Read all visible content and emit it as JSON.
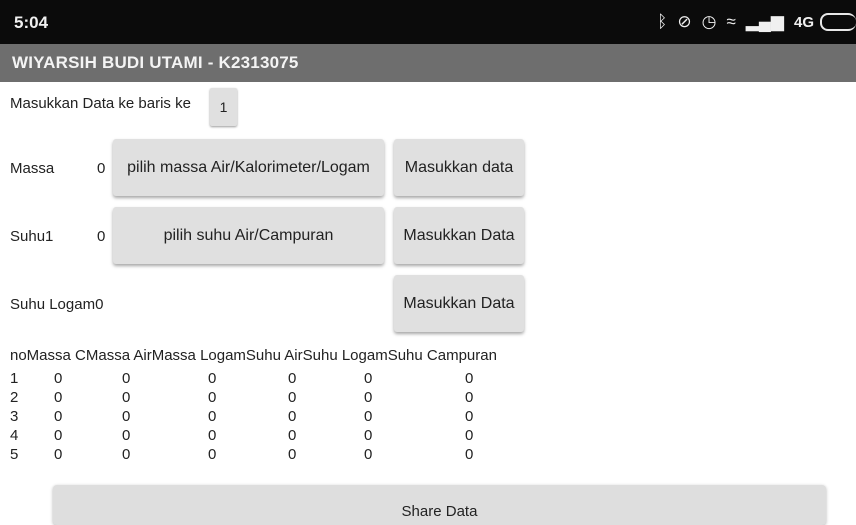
{
  "status_bar": {
    "time": "5:04",
    "network": "4G",
    "icons": [
      "bluetooth-icon",
      "mute-icon",
      "alarm-icon",
      "wifi-icon",
      "signal-icon",
      "battery-icon"
    ]
  },
  "app": {
    "title": "WIYARSIH BUDI UTAMI - K2313075"
  },
  "form": {
    "row_label": "Masukkan Data ke baris ke",
    "row_value": "1",
    "massa_label": "Massa",
    "massa_value": "0",
    "massa_picker": "pilih massa Air/Kalorimeter/Logam",
    "massa_submit": "Masukkan data",
    "suhu1_label": "Suhu1",
    "suhu1_value": "0",
    "suhu_picker": "pilih suhu Air/Campuran",
    "suhu1_submit": "Masukkan Data",
    "suhu_logam_label": "Suhu Logam0",
    "suhu_logam_submit": "Masukkan Data"
  },
  "table": {
    "header": "noMassa CMassa AirMassa LogamSuhu AirSuhu LogamSuhu Campuran",
    "rows": [
      [
        "1",
        "0",
        "0",
        "0",
        "0",
        "0",
        "0"
      ],
      [
        "2",
        "0",
        "0",
        "0",
        "0",
        "0",
        "0"
      ],
      [
        "3",
        "0",
        "0",
        "0",
        "0",
        "0",
        "0"
      ],
      [
        "4",
        "0",
        "0",
        "0",
        "0",
        "0",
        "0"
      ],
      [
        "5",
        "0",
        "0",
        "0",
        "0",
        "0",
        "0"
      ]
    ]
  },
  "share_button": "Share Data",
  "colors": {
    "status_bar": "#0b0b0b",
    "title_bar": "#6e6e6e",
    "button": "#e0e0e0"
  }
}
